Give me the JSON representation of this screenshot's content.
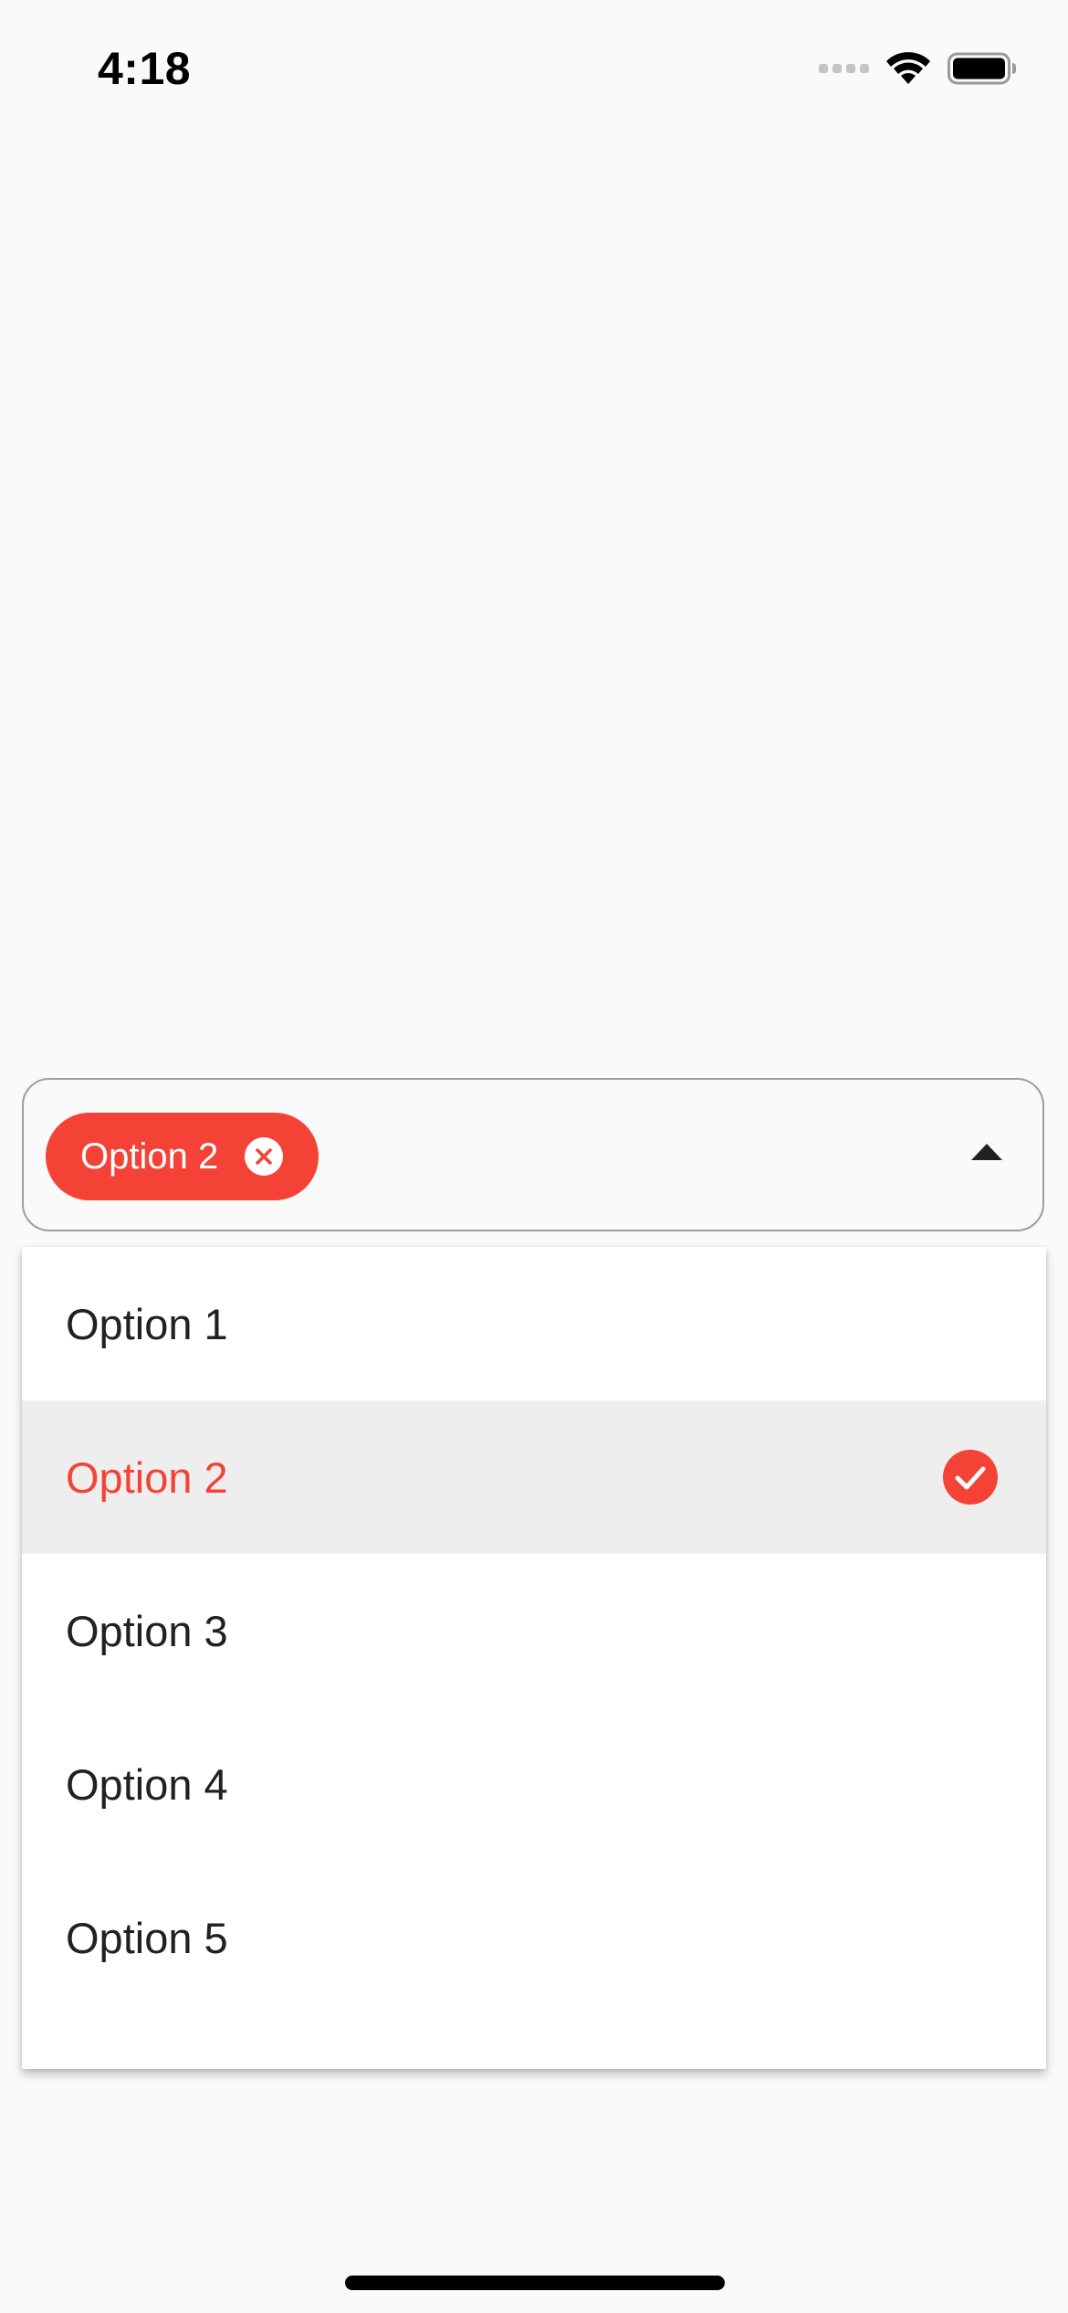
{
  "status_bar": {
    "time": "4:18"
  },
  "select": {
    "selected_chip": "Option 2",
    "chip_color": "#f44336",
    "expanded": true
  },
  "options": [
    {
      "label": "Option 1",
      "selected": false
    },
    {
      "label": "Option 2",
      "selected": true
    },
    {
      "label": "Option 3",
      "selected": false
    },
    {
      "label": "Option 4",
      "selected": false
    },
    {
      "label": "Option 5",
      "selected": false
    }
  ],
  "icons": {
    "chip_remove": "close-circle-icon",
    "dropdown": "arrow-up-icon",
    "selected_marker": "check-circle-icon"
  }
}
